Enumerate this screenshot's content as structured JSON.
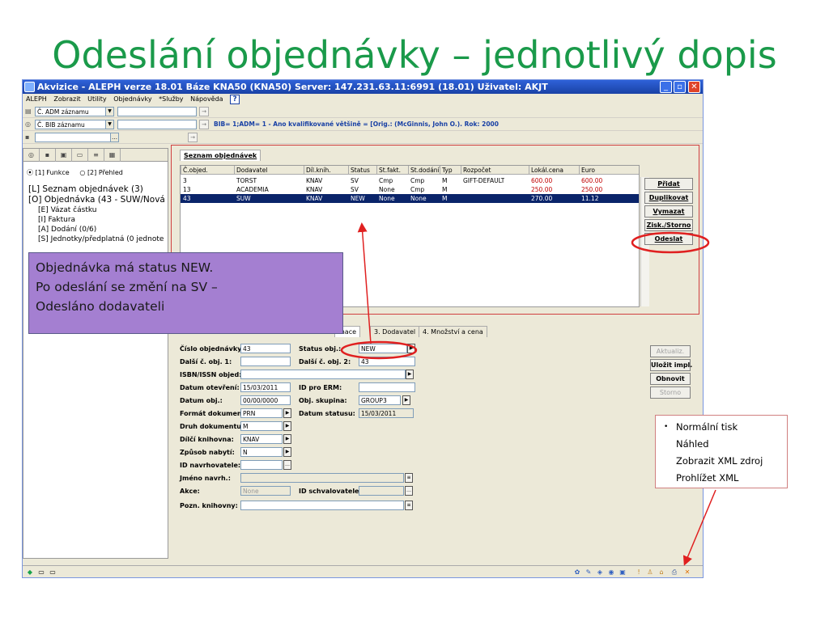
{
  "slide": {
    "title": "Odeslání objednávky – jednotlivý dopis"
  },
  "window": {
    "title": "Akvizice - ALEPH verze 18.01  Báze KNA50 (KNA50)  Server: 147.231.63.11:6991 (18.01)  Uživatel: AKJT",
    "controls": {
      "minimize": "_",
      "maximize": "▫",
      "close": "✕"
    }
  },
  "menu": [
    "ALEPH",
    "Zobrazit",
    "Utility",
    "Objednávky",
    "*Služby",
    "Nápověda"
  ],
  "toolbar": {
    "adm_label": "Č. ADM záznamu",
    "bib_label": "Č. BIB záznamu",
    "bib_info": "BIB= 1;ADM= 1 - Ano kvalifikované většině = [Orig.: (McGinnis, John O.). Rok: 2000"
  },
  "left_pane": {
    "radio_funkce": "[1] Funkce",
    "radio_prehled": "[2] Přehled",
    "tree": [
      "[L] Seznam objednávek (3)",
      "[O] Objednávka (43 - SUW/Nová",
      "[E] Vázat částku",
      "[I] Faktura",
      "[A] Dodání (0/6)",
      "[S] Jednotky/předplatná (0 jednote"
    ]
  },
  "order_list": {
    "tab_label": "Seznam objednávek",
    "columns": [
      "Č.objed.",
      "Dodavatel",
      "Díl.kníh.",
      "Status",
      "St.fakt.",
      "St.dodání",
      "Typ",
      "Rozpočet",
      "Lokál.cena",
      "Euro"
    ],
    "rows": [
      [
        "3",
        "TORST",
        "KNAV",
        "SV",
        "Cmp",
        "Cmp",
        "M",
        "GIFT-DEFAULT",
        "600.00",
        "600.00"
      ],
      [
        "13",
        "ACADEMIA",
        "KNAV",
        "SV",
        "None",
        "Cmp",
        "M",
        "",
        "250.00",
        "250.00"
      ],
      [
        "43",
        "SUW",
        "KNAV",
        "NEW",
        "None",
        "None",
        "M",
        "",
        "270.00",
        "11.12"
      ]
    ],
    "buttons": [
      "Přidat",
      "Duplikovat",
      "Vymazat",
      "Zisk./Storno",
      "Odeslat"
    ]
  },
  "detail_tabs": [
    "mace",
    "3. Dodavatel",
    "4. Množství a cena"
  ],
  "detail": {
    "cislo_objednavky_label": "Číslo objednávky:",
    "cislo_objednavky": "43",
    "status_obj_label": "Status obj.:",
    "status_obj": "NEW",
    "dalsi_c_obj_1_label": "Další č. obj. 1:",
    "dalsi_c_obj_1": "",
    "dalsi_c_obj_2_label": "Další č. obj. 2:",
    "dalsi_c_obj_2": "43",
    "isbn_label": "ISBN/ISSN objed:",
    "isbn": "",
    "datum_otevreni_label": "Datum otevření:",
    "datum_otevreni": "15/03/2011",
    "id_erm_label": "ID pro ERM:",
    "id_erm": "",
    "datum_obj_label": "Datum obj.:",
    "datum_obj": "00/00/0000",
    "obj_skupina_label": "Obj. skupina:",
    "obj_skupina": "GROUP3",
    "format_label": "Formát dokumen:",
    "format": "PRN",
    "datum_statusu_label": "Datum statusu:",
    "datum_statusu": "15/03/2011",
    "druh_label": "Druh dokumentu",
    "druh": "M",
    "dilci_label": "Dílčí knihovna:",
    "dilci": "KNAV",
    "zpusob_label": "Způsob nabytí:",
    "zpusob": "N",
    "id_navrh_label": "ID navrhovatele:",
    "id_navrh": "",
    "jmeno_label": "Jméno navrh.:",
    "jmeno": "",
    "akce_label": "Akce:",
    "akce": "None",
    "id_schval_label": "ID schvalovatele:",
    "id_schval": "",
    "pozn_label": "Pozn. knihovny:",
    "pozn": "",
    "buttons": [
      "Aktualiz.",
      "Uložit impl.",
      "Obnovit",
      "Storno"
    ]
  },
  "callout": {
    "line1": "Objednávka má status NEW.",
    "line2": "Po odeslání se změní na SV –",
    "line3": "Odesláno dodavateli"
  },
  "print_menu": {
    "bullet": "•",
    "items": [
      "Normální tisk",
      "Náhled",
      "Zobrazit XML zdroj",
      "Prohlížet XML"
    ]
  },
  "colors": {
    "title_green": "#1a9a4a",
    "callout_purple": "#a47fd1",
    "annotation_red": "#e02020",
    "selection_blue": "#0a246a"
  }
}
